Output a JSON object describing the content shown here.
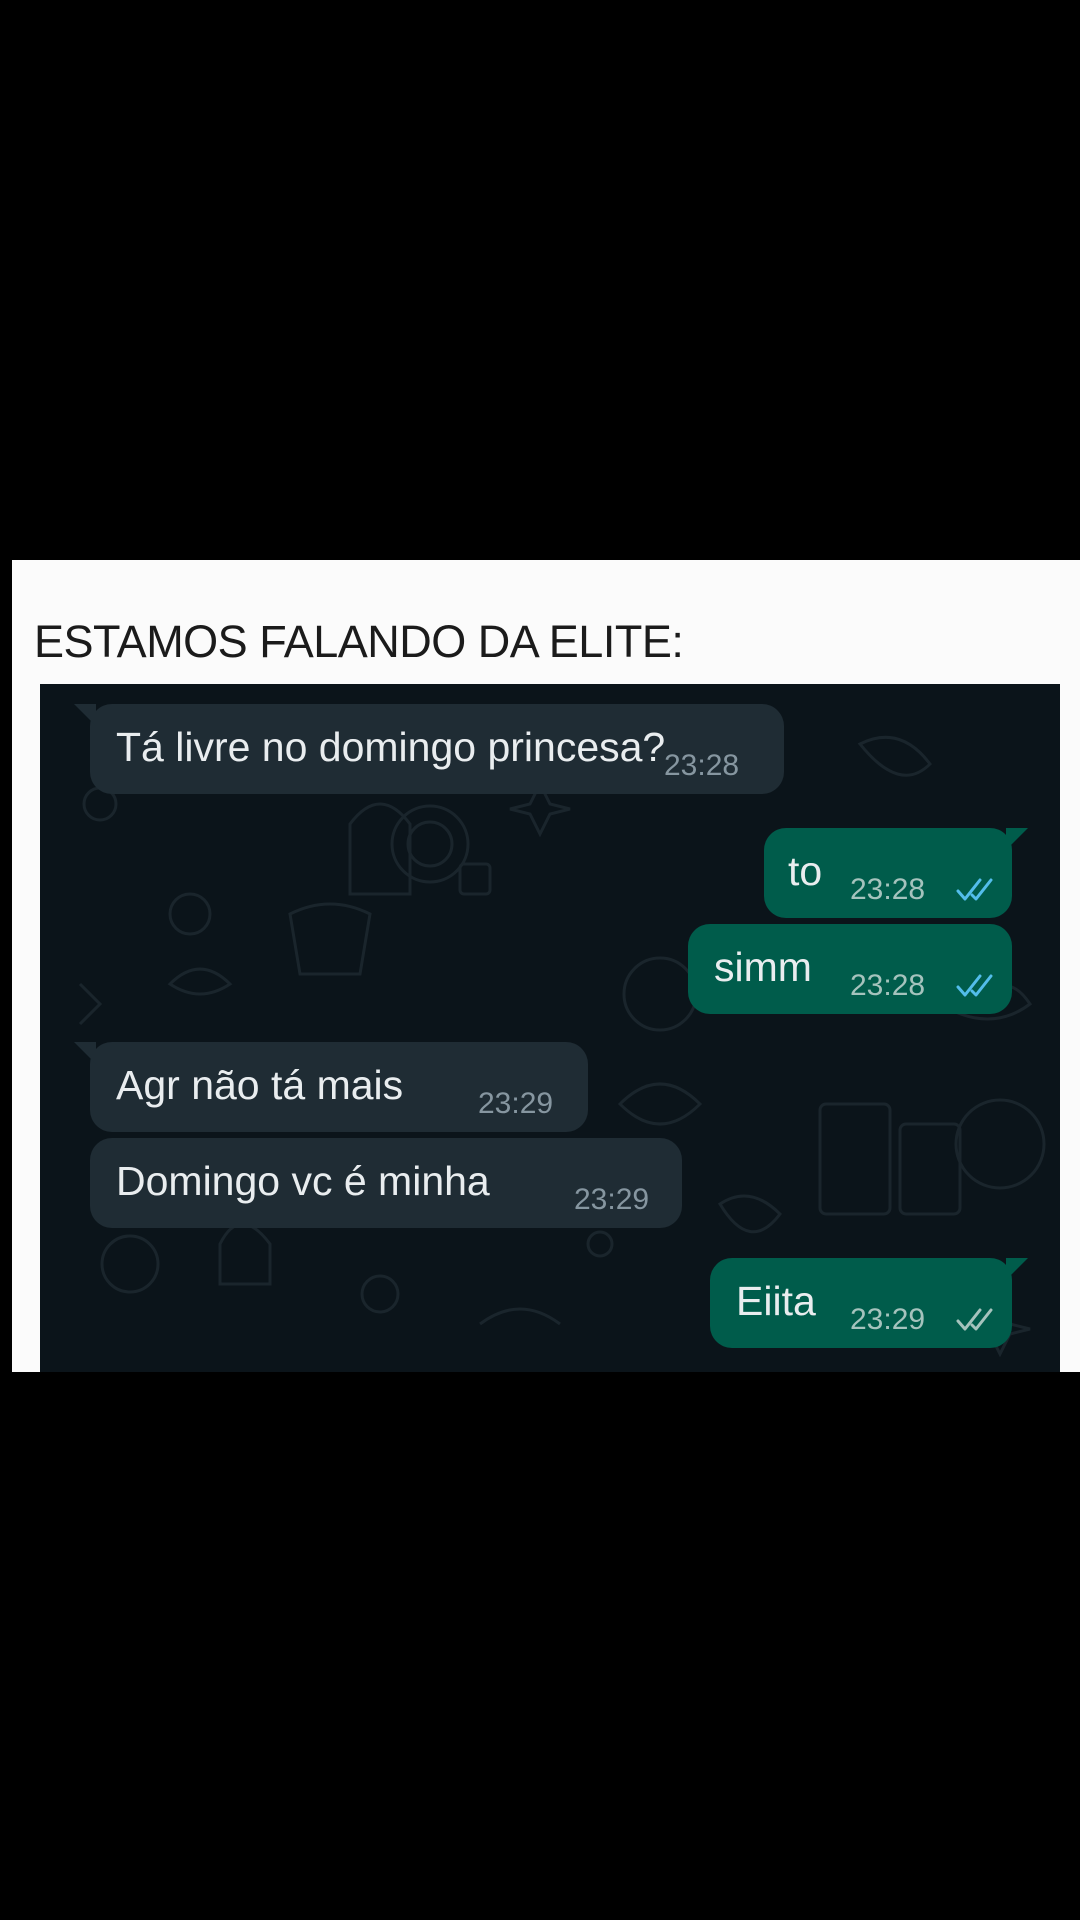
{
  "caption": "ESTAMOS FALANDO DA ELITE:",
  "colors": {
    "chat_background": "#0b141a",
    "incoming_bubble": "#1f2c34",
    "outgoing_bubble": "#005c4b",
    "read_tick": "#53bdeb",
    "delivered_tick": "#a5c3bd"
  },
  "messages": [
    {
      "direction": "incoming",
      "text": "Tá livre no domingo princesa?",
      "time": "23:28"
    },
    {
      "direction": "outgoing",
      "text": "to",
      "time": "23:28",
      "status": "read",
      "status_icon": "double-check-icon"
    },
    {
      "direction": "outgoing",
      "text": "simm",
      "time": "23:28",
      "status": "read",
      "status_icon": "double-check-icon"
    },
    {
      "direction": "incoming",
      "text": "Agr não tá mais",
      "time": "23:29"
    },
    {
      "direction": "incoming",
      "text": "Domingo vc é minha",
      "time": "23:29"
    },
    {
      "direction": "outgoing",
      "text": "Eiita",
      "time": "23:29",
      "status": "delivered",
      "status_icon": "double-check-icon"
    }
  ]
}
